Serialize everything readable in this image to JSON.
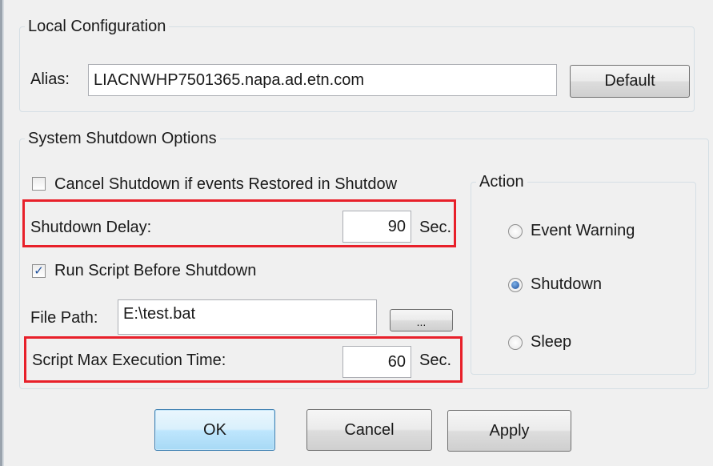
{
  "local_config": {
    "title": "Local Configuration",
    "alias_label": "Alias:",
    "alias_value": "LIACNWHP7501365.napa.ad.etn.com",
    "default_button": "Default"
  },
  "shutdown_options": {
    "title": "System Shutdown Options",
    "cancel_shutdown_label": "Cancel Shutdown if events Restored in Shutdow",
    "cancel_shutdown_checked": false,
    "shutdown_delay_label": "Shutdown Delay:",
    "shutdown_delay_value": "90",
    "shutdown_delay_unit": "Sec.",
    "run_script_label": "Run Script Before Shutdown",
    "run_script_checked": true,
    "checkmark": "✓",
    "file_path_label": "File Path:",
    "file_path_value": "E:\\test.bat",
    "browse_button": "...",
    "max_exec_label": "Script Max Execution Time:",
    "max_exec_value": "60",
    "max_exec_unit": "Sec."
  },
  "action": {
    "title": "Action",
    "options": [
      {
        "label": "Event Warning",
        "selected": false
      },
      {
        "label": "Shutdown",
        "selected": true
      },
      {
        "label": "Sleep",
        "selected": false
      }
    ]
  },
  "buttons": {
    "ok": "OK",
    "cancel": "Cancel",
    "apply": "Apply"
  },
  "colors": {
    "highlight": "#e8202a",
    "default_button_border": "#3c7fb1",
    "background": "#f0f0f0"
  }
}
